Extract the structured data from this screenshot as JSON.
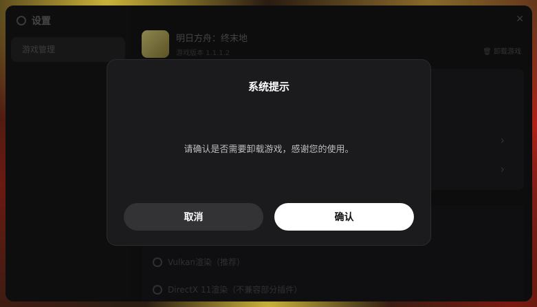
{
  "window": {
    "title": "设置",
    "sidebar_items": [
      "游戏管理"
    ],
    "game": {
      "name": "明日方舟：终末地",
      "subtitle": "游戏版本 1.1.1.2",
      "uninstall_label": "卸载游戏"
    },
    "options": [
      "Vulkan渲染（推荐）",
      "DirectX 11渲染（不兼容部分插件）"
    ]
  },
  "dialog": {
    "title": "系统提示",
    "message": "请确认是否需要卸载游戏，感谢您的使用。",
    "cancel_label": "取消",
    "confirm_label": "确认"
  },
  "colors": {
    "dialog_bg": "#1b1b1d",
    "cancel_bg": "#333336",
    "confirm_bg": "#ffffff"
  }
}
